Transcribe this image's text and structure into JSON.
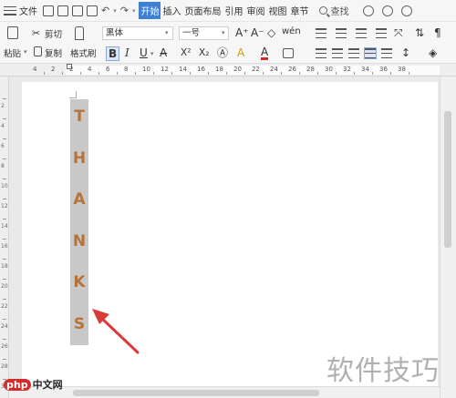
{
  "menubar": {
    "file_label": "文件",
    "tabs": [
      {
        "label": "开始",
        "active": true
      },
      {
        "label": "插入",
        "active": false
      },
      {
        "label": "页面布局",
        "active": false
      },
      {
        "label": "引用",
        "active": false
      },
      {
        "label": "审阅",
        "active": false
      },
      {
        "label": "视图",
        "active": false
      },
      {
        "label": "章节",
        "active": false
      }
    ],
    "search_label": "查找"
  },
  "ribbon": {
    "paste_label": "粘贴",
    "cut_label": "剪切",
    "copy_label": "复制",
    "format_painter_label": "格式刷",
    "font_name": "黑体",
    "font_size": "一号",
    "bold": "B",
    "italic": "I",
    "underline": "U",
    "font_color_glyph": "A",
    "grow_font_glyph": "A⁺",
    "shrink_font_glyph": "A⁻",
    "superscript_glyph": "X²",
    "subscript_glyph": "X₂",
    "highlight_glyph": "A",
    "wen_glyph": "wén"
  },
  "ruler": {
    "numbers": [
      "4",
      "2",
      "2",
      "4",
      "6",
      "8",
      "10",
      "12",
      "14",
      "16",
      "18",
      "20",
      "22",
      "24",
      "26",
      "28",
      "30",
      "32",
      "34",
      "36",
      "38"
    ]
  },
  "vruler": {
    "numbers": [
      "2",
      "4",
      "6",
      "8",
      "10",
      "12",
      "14",
      "16",
      "18",
      "20",
      "22",
      "24",
      "26",
      "28",
      "30"
    ]
  },
  "document": {
    "letters": [
      "T",
      "H",
      "A",
      "N",
      "K",
      "S"
    ],
    "letter_color": "#b5733a",
    "highlight_color": "#c8c8c8"
  },
  "watermark": {
    "text": "软件技巧"
  },
  "brand": {
    "logo": "php",
    "site": "中文网"
  },
  "colors": {
    "accent_tab": "#3f7fd6",
    "arrow": "#d93a3a"
  }
}
